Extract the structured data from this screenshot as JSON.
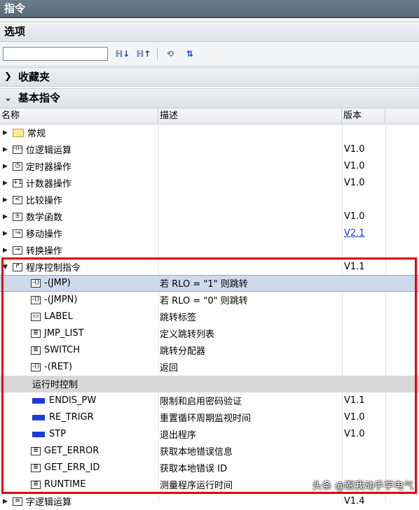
{
  "window": {
    "title": "指令"
  },
  "options": {
    "label": "选项",
    "search_value": ""
  },
  "toolbar": {
    "btn1": "ℍ↓",
    "btn2": "ℍ↑",
    "btn3": "⟲",
    "btn4": "⇅"
  },
  "sections": {
    "favorites": "收藏夹",
    "basic": "基本指令"
  },
  "columns": {
    "name": "名称",
    "desc": "描述",
    "version": "版本"
  },
  "folders": [
    {
      "name": "常规",
      "version": "",
      "icon": "folder-icon"
    },
    {
      "name": "位逻辑运算",
      "version": "V1.0",
      "icon": "bit-logic-icon"
    },
    {
      "name": "定时器操作",
      "version": "V1.0",
      "icon": "timer-icon"
    },
    {
      "name": "计数器操作",
      "version": "V1.0",
      "icon": "counter-icon"
    },
    {
      "name": "比较操作",
      "version": "",
      "icon": "compare-icon"
    },
    {
      "name": "数学函数",
      "version": "V1.0",
      "icon": "math-icon"
    },
    {
      "name": "移动操作",
      "version": "V2.1",
      "icon": "move-icon"
    },
    {
      "name": "转换操作",
      "version": "",
      "icon": "convert-icon"
    },
    {
      "name": "程序控制指令",
      "version": "V1.1",
      "icon": "program-control-icon"
    }
  ],
  "program_control_items": [
    {
      "name": "-(JMP)",
      "desc": "若 RLO = \"1\" 则跳转",
      "version": ""
    },
    {
      "name": "-(JMPN)",
      "desc": "若 RLO = \"0\" 则跳转",
      "version": ""
    },
    {
      "name": "LABEL",
      "desc": "跳转标签",
      "version": ""
    },
    {
      "name": "JMP_LIST",
      "desc": "定义跳转列表",
      "version": ""
    },
    {
      "name": "SWITCH",
      "desc": "跳转分配器",
      "version": ""
    },
    {
      "name": "-(RET)",
      "desc": "返回",
      "version": ""
    }
  ],
  "runtime_group": {
    "label": "运行时控制"
  },
  "runtime_items": [
    {
      "name": "ENDIS_PW",
      "desc": "限制和启用密码验证",
      "version": "V1.1"
    },
    {
      "name": "RE_TRIGR",
      "desc": "重置循环周期监视时间",
      "version": "V1.0"
    },
    {
      "name": "STP",
      "desc": "退出程序",
      "version": "V1.0"
    },
    {
      "name": "GET_ERROR",
      "desc": "获取本地错误信息",
      "version": ""
    },
    {
      "name": "GET_ERR_ID",
      "desc": "获取本地错误 ID",
      "version": ""
    },
    {
      "name": "RUNTIME",
      "desc": "测量程序运行时间",
      "version": ""
    }
  ],
  "last_row": {
    "name": "字逻辑运算",
    "version": "V1.4"
  },
  "watermark": "头条 @跟我动手学电气"
}
